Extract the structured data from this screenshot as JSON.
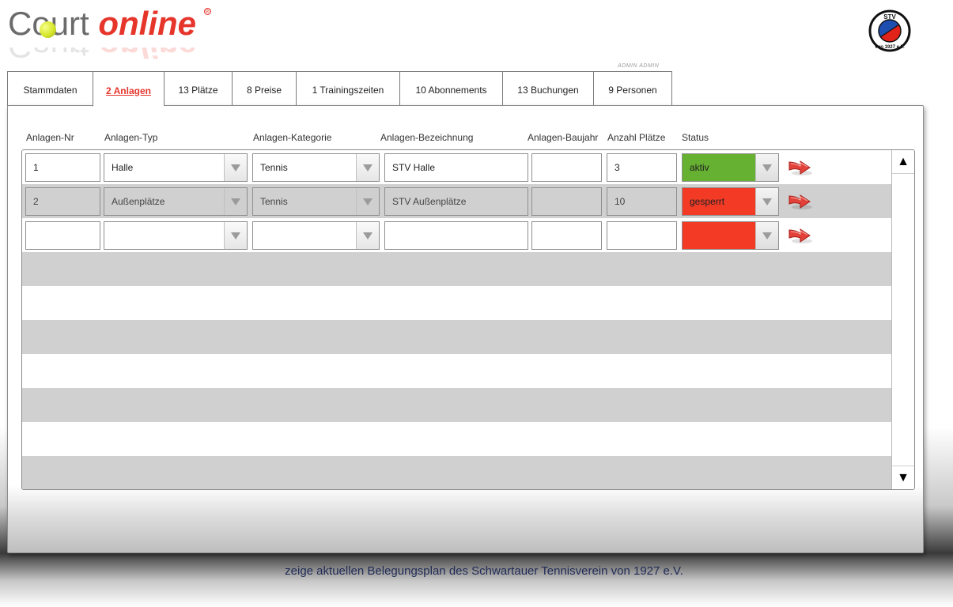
{
  "brand": {
    "court": "Court",
    "online": "online",
    "reg": "®"
  },
  "emblem": {
    "top_text": "STV",
    "bottom_text": "von 1927 e.V."
  },
  "user_label": "ADMIN ADMIN",
  "tabs": [
    {
      "label": "Stammdaten"
    },
    {
      "label": "2 Anlagen"
    },
    {
      "label": "13 Plätze"
    },
    {
      "label": "8 Preise"
    },
    {
      "label": "1 Trainingszeiten"
    },
    {
      "label": "10 Abonnements"
    },
    {
      "label": "13 Buchungen"
    },
    {
      "label": "9 Personen"
    }
  ],
  "columns": {
    "nr": "Anlagen-Nr",
    "typ": "Anlagen-Typ",
    "kategorie": "Anlagen-Kategorie",
    "bezeichnung": "Anlagen-Bezeichnung",
    "baujahr": "Anlagen-Baujahr",
    "plaetze": "Anzahl Plätze",
    "status": "Status"
  },
  "rows": [
    {
      "nr": "1",
      "typ": "Halle",
      "kategorie": "Tennis",
      "bezeichnung": "STV Halle",
      "baujahr": "",
      "plaetze": "3",
      "status": "aktiv",
      "status_color": "#66b032"
    },
    {
      "nr": "2",
      "typ": "Außenplätze",
      "kategorie": "Tennis",
      "bezeichnung": "STV Außenplätze",
      "baujahr": "",
      "plaetze": "10",
      "status": "gesperrt",
      "status_color": "#f33a25"
    },
    {
      "nr": "",
      "typ": "",
      "kategorie": "",
      "bezeichnung": "",
      "baujahr": "",
      "plaetze": "",
      "status": "",
      "status_color": "#f33a25"
    }
  ],
  "scrollbar": {
    "up": "▲",
    "down": "▼"
  },
  "footer_link": "zeige aktuellen Belegungsplan des Schwartauer Tennisverein von 1927 e.V."
}
